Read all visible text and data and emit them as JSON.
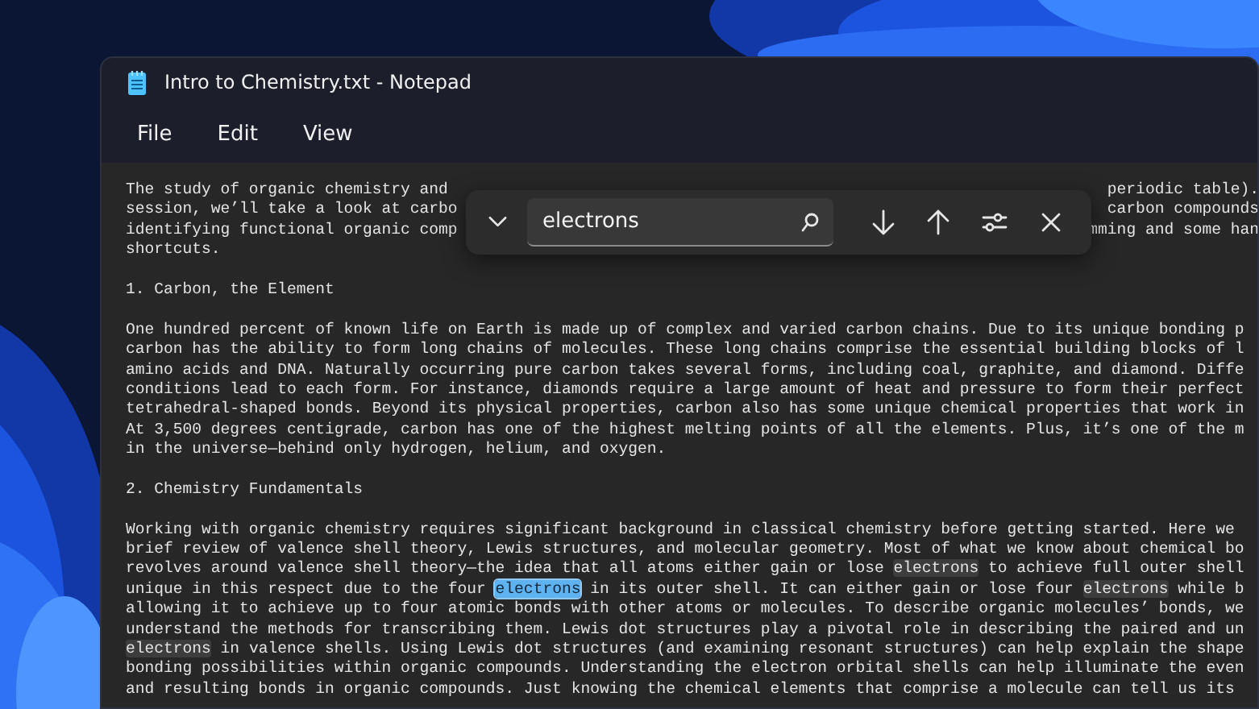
{
  "window": {
    "title": "Intro to Chemistry.txt - Notepad"
  },
  "menu": [
    "File",
    "Edit",
    "View"
  ],
  "find_bar": {
    "value": "electrons"
  },
  "editor": {
    "lines": [
      {
        "kind": "split",
        "left": "The study of organic chemistry and",
        "right": "periodic table)."
      },
      {
        "kind": "split",
        "left": "session, we’ll take a look at carbo",
        "right": "carbon compounds"
      },
      {
        "kind": "split",
        "left": "identifying functional organic comp",
        "right": "mming and some han"
      },
      {
        "kind": "text",
        "text": "shortcuts."
      },
      {
        "kind": "blank"
      },
      {
        "kind": "text",
        "text": "1. Carbon, the Element"
      },
      {
        "kind": "blank"
      },
      {
        "kind": "text",
        "text": "One hundred percent of known life on Earth is made up of complex and varied carbon chains. Due to its unique bonding p"
      },
      {
        "kind": "text",
        "text": "carbon has the ability to form long chains of molecules. These long chains comprise the essential building blocks of l"
      },
      {
        "kind": "text",
        "text": "amino acids and DNA. Naturally occurring pure carbon takes several forms, including coal, graphite, and diamond. Diffe"
      },
      {
        "kind": "text",
        "text": "conditions lead to each form. For instance, diamonds require a large amount of heat and pressure to form their perfect"
      },
      {
        "kind": "text",
        "text": "tetrahedral-shaped bonds. Beyond its physical properties, carbon also has some unique chemical properties that work in"
      },
      {
        "kind": "text",
        "text": "At 3,500 degrees centigrade, carbon has one of the highest melting points of all the elements. Plus, it’s one of the m"
      },
      {
        "kind": "text",
        "text": "in the universe—behind only hydrogen, helium, and oxygen."
      },
      {
        "kind": "blank"
      },
      {
        "kind": "text",
        "text": "2. Chemistry Fundamentals"
      },
      {
        "kind": "blank"
      },
      {
        "kind": "text",
        "text": "Working with organic chemistry requires significant background in classical chemistry before getting started. Here we"
      },
      {
        "kind": "text",
        "text": "brief review of valence shell theory, Lewis structures, and molecular geometry. Most of what we know about chemical bo"
      },
      {
        "kind": "segments",
        "segments": [
          {
            "kind": "text",
            "text": "revolves around valence shell theory—the idea that all atoms either gain or lose "
          },
          {
            "kind": "match",
            "text": "electrons"
          },
          {
            "kind": "text",
            "text": " to achieve full outer shell"
          }
        ]
      },
      {
        "kind": "segments",
        "segments": [
          {
            "kind": "text",
            "text": "unique in this respect due to the four "
          },
          {
            "kind": "current",
            "text": "electrons"
          },
          {
            "kind": "text",
            "text": " in its outer shell. It can either gain or lose four "
          },
          {
            "kind": "match",
            "text": "electrons"
          },
          {
            "kind": "text",
            "text": " while b"
          }
        ]
      },
      {
        "kind": "text",
        "text": "allowing it to achieve up to four atomic bonds with other atoms or molecules. To describe organic molecules’ bonds, we"
      },
      {
        "kind": "text",
        "text": "understand the methods for transcribing them. Lewis dot structures play a pivotal role in describing the paired and un"
      },
      {
        "kind": "segments",
        "segments": [
          {
            "kind": "match",
            "text": "electrons"
          },
          {
            "kind": "text",
            "text": " in valence shells. Using Lewis dot structures (and examining resonant structures) can help explain the shape"
          }
        ]
      },
      {
        "kind": "text",
        "text": "bonding possibilities within organic compounds. Understanding the electron orbital shells can help illuminate the even"
      },
      {
        "kind": "text",
        "text": "and resulting bonds in organic compounds. Just knowing the chemical elements that comprise a molecule can tell us its"
      }
    ]
  }
}
